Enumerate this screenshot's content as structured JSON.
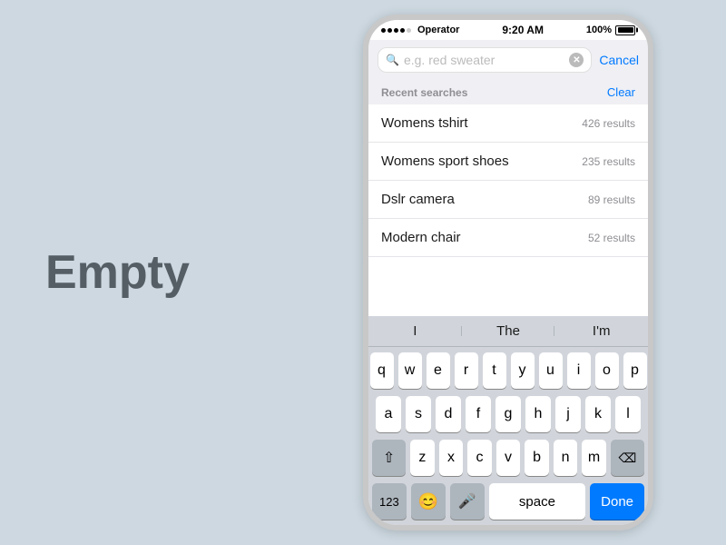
{
  "left": {
    "label": "Empty"
  },
  "phone": {
    "status_bar": {
      "signal": "●●●●○",
      "carrier": "Operator",
      "time": "9:20 AM",
      "battery": "100%"
    },
    "search": {
      "placeholder": "e.g. red sweater",
      "cancel_label": "Cancel"
    },
    "recent_searches": {
      "section_title": "Recent searches",
      "clear_label": "Clear",
      "items": [
        {
          "name": "Womens tshirt",
          "count": "426 results"
        },
        {
          "name": "Womens sport shoes",
          "count": "235 results"
        },
        {
          "name": "Dslr camera",
          "count": "89 results"
        },
        {
          "name": "Modern chair",
          "count": "52 results"
        }
      ]
    },
    "autocorrect": {
      "suggestions": [
        "I",
        "The",
        "I'm"
      ]
    },
    "keyboard": {
      "rows": [
        [
          "q",
          "w",
          "e",
          "r",
          "t",
          "y",
          "u",
          "i",
          "o",
          "p"
        ],
        [
          "a",
          "s",
          "d",
          "f",
          "g",
          "h",
          "j",
          "k",
          "l"
        ],
        [
          "⇧",
          "z",
          "x",
          "c",
          "v",
          "b",
          "n",
          "m",
          "⌫"
        ]
      ],
      "bottom": {
        "num_label": "123",
        "emoji": "😊",
        "mic": "🎤",
        "space_label": "space",
        "done_label": "Done"
      }
    }
  }
}
